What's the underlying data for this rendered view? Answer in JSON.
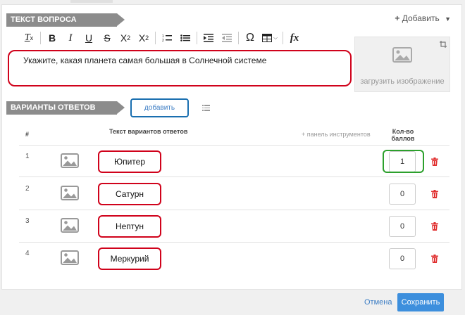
{
  "question_section": {
    "title": "ТЕКСТ ВОПРОСА",
    "add_menu_label": "Добавить"
  },
  "toolbar": {
    "buttons": [
      {
        "name": "clear-format-icon",
        "glyph": "T"
      },
      {
        "name": "bold-icon",
        "glyph": "B"
      },
      {
        "name": "italic-icon",
        "glyph": "I"
      },
      {
        "name": "underline-icon",
        "glyph": "U"
      },
      {
        "name": "strikethrough-icon",
        "glyph": "S"
      },
      {
        "name": "subscript-icon",
        "glyph": "X"
      },
      {
        "name": "superscript-icon",
        "glyph": "X"
      },
      {
        "name": "numbered-list-icon",
        "glyph": "1≡"
      },
      {
        "name": "bulleted-list-icon",
        "glyph": "•≡"
      },
      {
        "name": "indent-icon",
        "glyph": "⇥"
      },
      {
        "name": "outdent-icon",
        "glyph": "⇤"
      },
      {
        "name": "special-char-icon",
        "glyph": "Ω"
      },
      {
        "name": "table-icon",
        "glyph": "▦"
      },
      {
        "name": "formula-icon",
        "glyph": "fx"
      }
    ]
  },
  "question": {
    "text": "Укажите, какая планета самая большая в Солнечной системе"
  },
  "image_upload": {
    "label": "загрузить изображение"
  },
  "answers_section": {
    "title": "ВАРИАНТЫ ОТВЕТОВ",
    "add_label": "добавить",
    "columns": {
      "num": "#",
      "text": "Текст вариантов ответов",
      "toolbar_hint": "+ панель инструментов",
      "score_line1": "Кол-во",
      "score_line2": "баллов"
    },
    "rows": [
      {
        "num": "1",
        "text": "Юпитер",
        "score": "1"
      },
      {
        "num": "2",
        "text": "Сатурн",
        "score": "0"
      },
      {
        "num": "3",
        "text": "Нептун",
        "score": "0"
      },
      {
        "num": "4",
        "text": "Меркурий",
        "score": "0"
      }
    ]
  },
  "footer": {
    "cancel_label": "Отмена",
    "save_label": "Сохранить"
  },
  "colors": {
    "highlight_red": "#d0021b",
    "highlight_blue": "#1a6fb0",
    "highlight_green": "#2ca02c",
    "primary": "#3d8fdd",
    "trash": "#e03030"
  }
}
